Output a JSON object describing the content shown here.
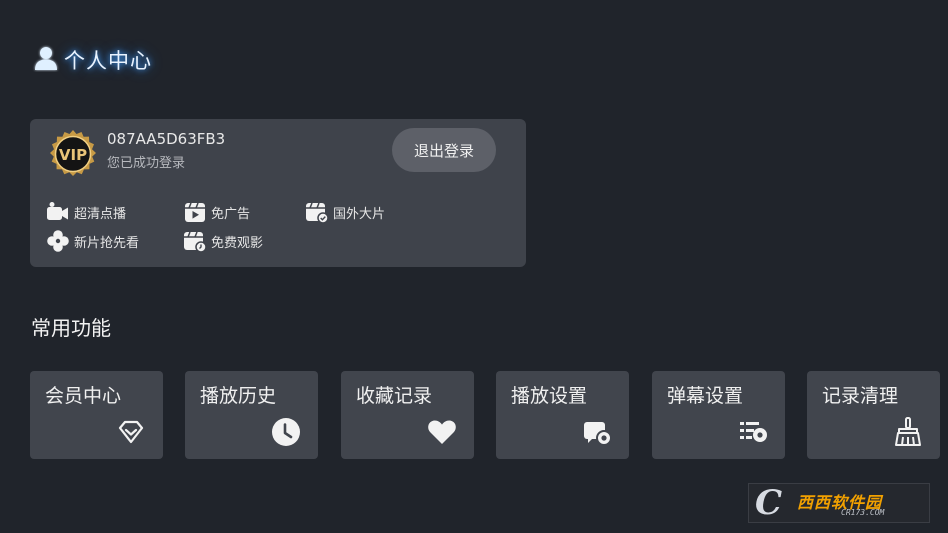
{
  "header": {
    "title": "个人中心",
    "icon": "user-icon",
    "color": "#4aa6ff"
  },
  "user": {
    "vip_text": "VIP",
    "id": "087AA5D63FB3",
    "status": "您已成功登录",
    "logout_label": "退出登录"
  },
  "perks": [
    {
      "label": "超清点播",
      "icon": "video-camera-icon"
    },
    {
      "label": "免广告",
      "icon": "play-box-icon"
    },
    {
      "label": "国外大片",
      "icon": "calendar-check-icon"
    },
    {
      "label": "新片抢先看",
      "icon": "aperture-icon"
    },
    {
      "label": "免费观影",
      "icon": "calendar-clock-icon"
    }
  ],
  "functions": {
    "title": "常用功能",
    "items": [
      {
        "label": "会员中心",
        "icon": "diamond-icon"
      },
      {
        "label": "播放历史",
        "icon": "clock-icon"
      },
      {
        "label": "收藏记录",
        "icon": "heart-icon"
      },
      {
        "label": "播放设置",
        "icon": "screen-settings-icon"
      },
      {
        "label": "弹幕设置",
        "icon": "danmaku-settings-icon"
      },
      {
        "label": "记录清理",
        "icon": "broom-icon"
      }
    ]
  },
  "watermark": {
    "logo": "C",
    "main": "西西软件园",
    "sub": "CR173.COM"
  },
  "colors": {
    "background": "#20242b",
    "card": "#3f434b",
    "tile": "#41454d",
    "accent": "#4aa6ff",
    "gold": "#e2b35a"
  }
}
